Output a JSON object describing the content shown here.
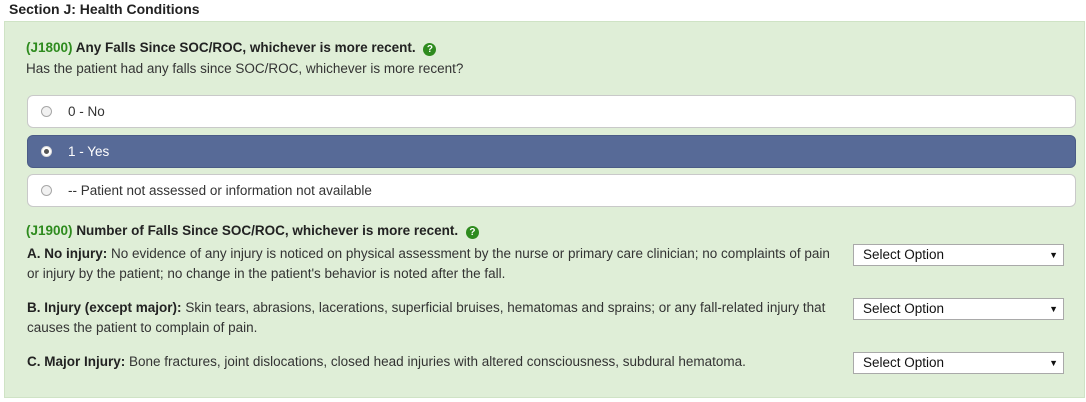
{
  "section": {
    "title": "Section J: Health Conditions"
  },
  "j1800": {
    "code": "(J1800)",
    "title": "Any Falls Since SOC/ROC, whichever is more recent.",
    "help_icon": "question-circle-icon",
    "subtitle": "Has the patient had any falls since SOC/ROC, whichever is more recent?",
    "options": [
      {
        "label": "0 - No",
        "selected": false
      },
      {
        "label": "1 - Yes",
        "selected": true
      },
      {
        "label": "-- Patient not assessed or information not available",
        "selected": false
      }
    ]
  },
  "j1900": {
    "code": "(J1900)",
    "title": "Number of Falls Since SOC/ROC, whichever is more recent.",
    "help_icon": "question-circle-icon",
    "rows": [
      {
        "label": "A. No injury:",
        "text": "No evidence of any injury is noticed on physical assessment by the nurse or primary care clinician; no complaints of pain or injury by the patient; no change in the patient's behavior is noted after the fall.",
        "select_value": "Select Option"
      },
      {
        "label": "B. Injury (except major):",
        "text": "Skin tears, abrasions, lacerations, superficial bruises, hematomas and sprains; or any fall-related injury that causes the patient to complain of pain.",
        "select_value": "Select Option"
      },
      {
        "label": "C. Major Injury:",
        "text": "Bone fractures, joint dislocations, closed head injuries with altered consciousness, subdural hematoma.",
        "select_value": "Select Option"
      }
    ]
  },
  "colors": {
    "panel_bg": "#dfeed7",
    "code_green": "#2e8b1e",
    "selected_option_bg": "#576a97"
  }
}
